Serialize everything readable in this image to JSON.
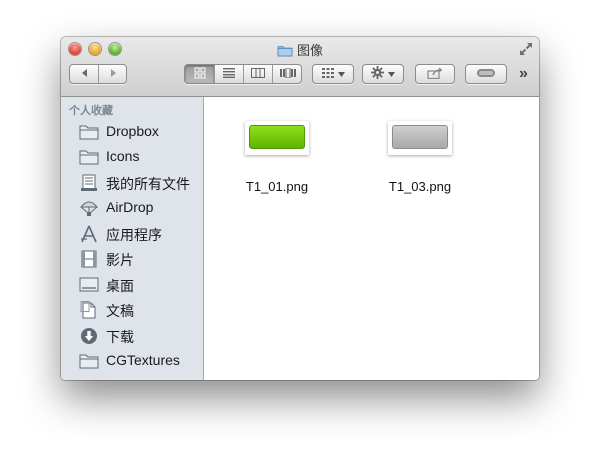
{
  "window": {
    "title": "图像"
  },
  "toolbar": {
    "back_icon": "chevron-left-icon",
    "forward_icon": "chevron-right-icon",
    "view_modes": [
      "icon-view",
      "list-view",
      "column-view",
      "coverflow-view"
    ],
    "arrange_icon": "arrange-grid-icon",
    "action_icon": "gear-icon",
    "share_icon": "share-icon",
    "tags_icon": "tag-toggle-icon",
    "overflow_label": "»"
  },
  "sidebar": {
    "header": "个人收藏",
    "items": [
      {
        "label": "Dropbox",
        "icon": "folder-icon"
      },
      {
        "label": "Icons",
        "icon": "folder-icon"
      },
      {
        "label": "我的所有文件",
        "icon": "all-files-icon"
      },
      {
        "label": "AirDrop",
        "icon": "airdrop-icon"
      },
      {
        "label": "应用程序",
        "icon": "applications-icon"
      },
      {
        "label": "影片",
        "icon": "movies-icon"
      },
      {
        "label": "桌面",
        "icon": "desktop-icon"
      },
      {
        "label": "文稿",
        "icon": "documents-icon"
      },
      {
        "label": "下载",
        "icon": "downloads-icon"
      },
      {
        "label": "CGTextures",
        "icon": "folder-icon"
      }
    ]
  },
  "files": [
    {
      "name": "T1_01.png",
      "preview_color": "#6cc40b"
    },
    {
      "name": "T1_03.png",
      "preview_color": "#b7b7b7"
    }
  ],
  "colors": {
    "sidebar_bg": "#dee4ea",
    "accent_green": "#6cc40b"
  }
}
